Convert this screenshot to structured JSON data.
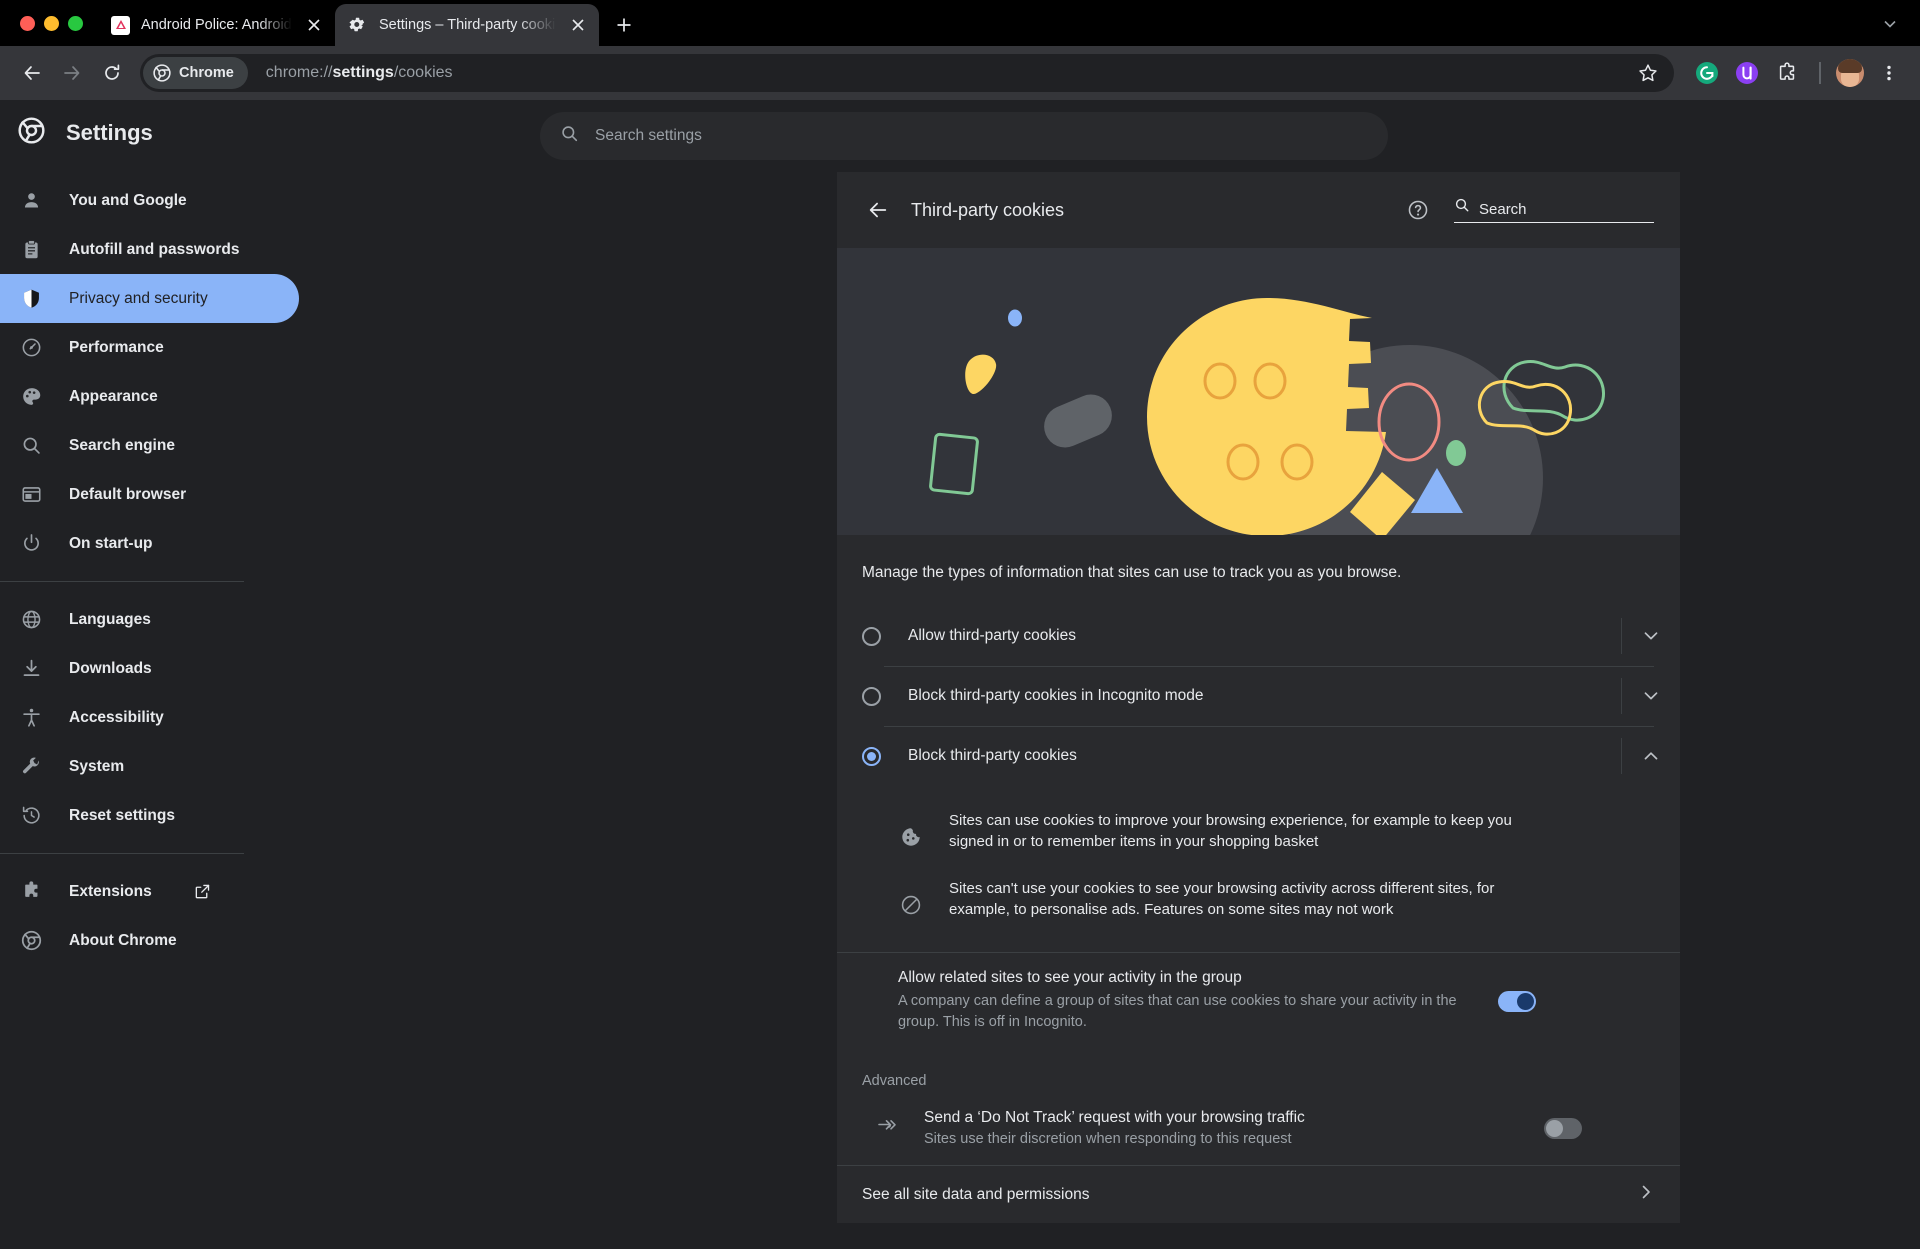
{
  "window": {
    "traffic_lights": [
      "close",
      "minimize",
      "maximize"
    ],
    "new_tab_label": "+",
    "tabs": [
      {
        "title": "Android Police: Android news",
        "favicon": "android-police-favicon",
        "active": false
      },
      {
        "title": "Settings – Third-party cookie",
        "favicon": "settings-gear-favicon",
        "active": true
      }
    ]
  },
  "toolbar": {
    "back_icon": "back-arrow-icon",
    "forward_icon": "forward-arrow-icon",
    "reload_icon": "reload-icon",
    "chrome_chip_label": "Chrome",
    "url_prefix": "chrome://",
    "url_bold": "settings",
    "url_suffix": "/cookies",
    "star_icon": "bookmark-star-icon",
    "extensions": [
      {
        "name": "grammarly-extension-icon",
        "color": "#15c39a",
        "letter": "G"
      },
      {
        "name": "purple-extension-icon",
        "color": "#8b3ff2",
        "letter": "Ɱ"
      }
    ],
    "puzzle_icon": "extensions-puzzle-icon",
    "avatar_name": "profile-avatar",
    "menu_icon": "three-dot-menu-icon"
  },
  "sidebar": {
    "logo": "chrome-logo-icon",
    "title": "Settings",
    "groups": [
      {
        "items": [
          {
            "label": "You and Google",
            "icon": "person-icon",
            "selected": false
          },
          {
            "label": "Autofill and passwords",
            "icon": "clipboard-icon",
            "selected": false
          },
          {
            "label": "Privacy and security",
            "icon": "shield-icon",
            "selected": true
          },
          {
            "label": "Performance",
            "icon": "speedometer-icon",
            "selected": false
          },
          {
            "label": "Appearance",
            "icon": "palette-icon",
            "selected": false
          },
          {
            "label": "Search engine",
            "icon": "magnifier-icon",
            "selected": false
          },
          {
            "label": "Default browser",
            "icon": "browser-window-icon",
            "selected": false
          },
          {
            "label": "On start-up",
            "icon": "power-icon",
            "selected": false
          }
        ]
      },
      {
        "items": [
          {
            "label": "Languages",
            "icon": "globe-icon",
            "selected": false
          },
          {
            "label": "Downloads",
            "icon": "download-icon",
            "selected": false
          },
          {
            "label": "Accessibility",
            "icon": "accessibility-icon",
            "selected": false
          },
          {
            "label": "System",
            "icon": "wrench-icon",
            "selected": false
          },
          {
            "label": "Reset settings",
            "icon": "history-restore-icon",
            "selected": false
          }
        ]
      },
      {
        "items": [
          {
            "label": "Extensions",
            "icon": "puzzle-piece-icon",
            "external": true,
            "selected": false
          },
          {
            "label": "About Chrome",
            "icon": "chrome-logo-icon",
            "selected": false
          }
        ]
      }
    ]
  },
  "search": {
    "placeholder": "Search settings",
    "icon": "search-icon",
    "value": ""
  },
  "main": {
    "back_icon": "back-arrow-icon",
    "title": "Third-party cookies",
    "help_icon": "help-circle-icon",
    "page_search": {
      "icon": "search-icon",
      "placeholder": "Search",
      "value": ""
    },
    "banner": {
      "name": "cookie-illustration",
      "bg": "#32343a",
      "cookie_color": "#fdd663",
      "blob_color": "#5f6368",
      "accents": [
        "#8ab4f8",
        "#81c995",
        "#f28b82",
        "#fdd663"
      ]
    },
    "intro": "Manage the types of information that sites can use to track you as you browse.",
    "options": [
      {
        "label": "Allow third-party cookies",
        "selected": false,
        "expanded": false
      },
      {
        "label": "Block third-party cookies in Incognito mode",
        "selected": false,
        "expanded": false
      },
      {
        "label": "Block third-party cookies",
        "selected": true,
        "expanded": true
      }
    ],
    "expanded_details": [
      {
        "icon": "cookie-icon",
        "text": "Sites can use cookies to improve your browsing experience, for example to keep you signed in or to remember items in your shopping basket"
      },
      {
        "icon": "block-slash-icon",
        "text": "Sites can't use your cookies to see your browsing activity across different sites, for example, to personalise ads. Features on some sites may not work"
      }
    ],
    "related_sites": {
      "title": "Allow related sites to see your activity in the group",
      "subtitle": "A company can define a group of sites that can use cookies to share your activity in the group. This is off in Incognito.",
      "toggle_on": true
    },
    "advanced_label": "Advanced",
    "do_not_track": {
      "icon": "double-chevron-icon",
      "title": "Send a ‘Do Not Track’ request with your browsing traffic",
      "subtitle": "Sites use their discretion when responding to this request",
      "toggle_on": false
    },
    "see_all": {
      "label": "See all site data and permissions",
      "icon": "chevron-right-icon"
    }
  },
  "colors": {
    "accent_blue": "#8ab4f8",
    "page_bg": "#202124",
    "card_bg": "#292a2d",
    "toolbar_bg": "#35363a",
    "text_primary": "#e8eaed",
    "text_secondary": "#9aa0a6"
  }
}
